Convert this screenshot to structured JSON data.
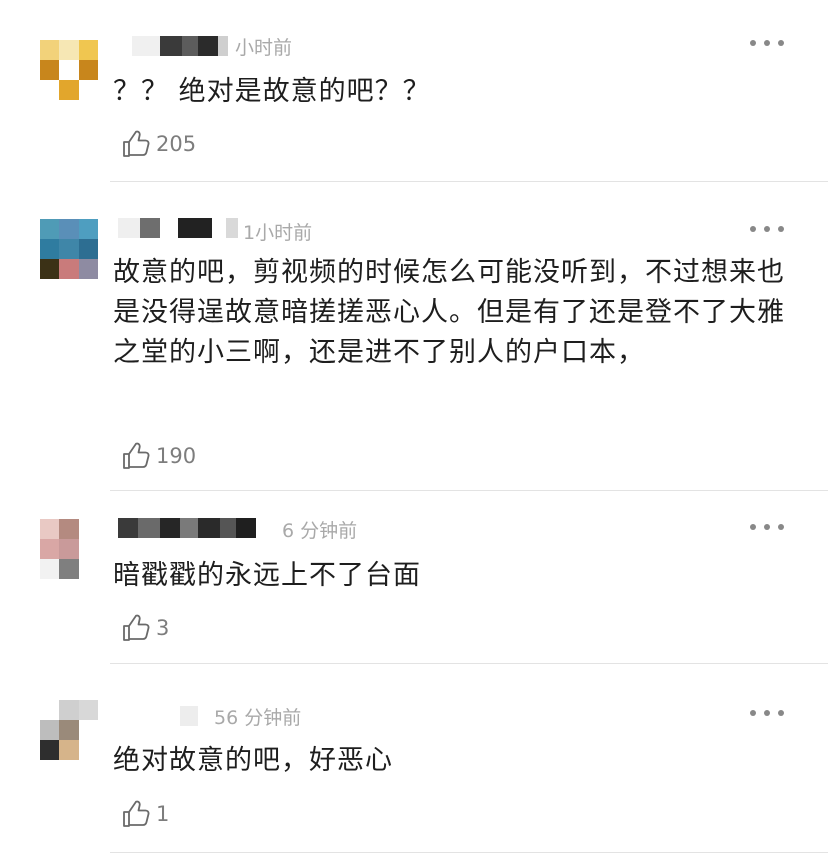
{
  "comments": [
    {
      "time": "小时前",
      "text": "？？ 绝对是故意的吧？？",
      "likes": "205"
    },
    {
      "time": "1小时前",
      "text": "故意的吧，剪视频的时候怎么可能没听到，不过想来也是没得逞故意暗搓搓恶心人。但是有了还是登不了大雅之堂的小三啊，还是进不了别人的户口本，",
      "likes": "190"
    },
    {
      "time": "6 分钟前",
      "text": "暗戳戳的永远上不了台面",
      "likes": "3"
    },
    {
      "time": "56 分钟前",
      "text": "绝对故意的吧，好恶心",
      "likes": "1"
    }
  ],
  "icons": {
    "more": "more-dots-icon",
    "like": "thumbs-up-icon"
  },
  "colors": {
    "text": "#1e1e1e",
    "meta": "#a9a9a9",
    "divider": "#e3e3e3"
  }
}
